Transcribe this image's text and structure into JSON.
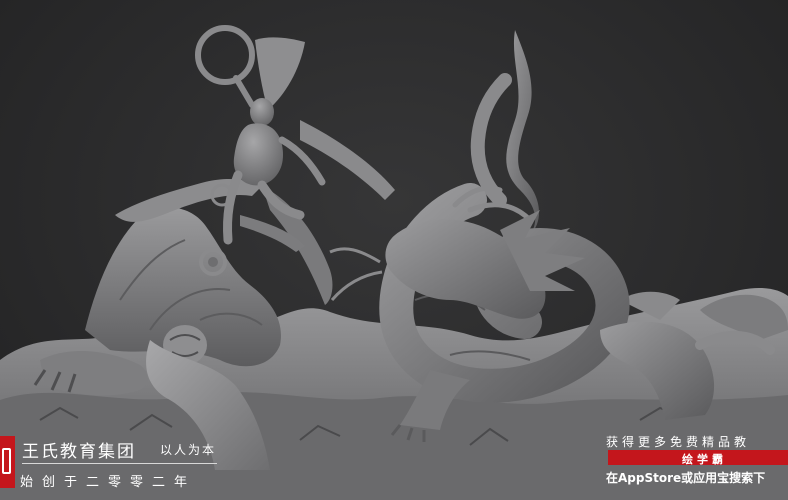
{
  "image": {
    "subject": "",
    "background_color": "#2a2a2b",
    "sculpt_color": "#8a8a8c"
  },
  "brand": {
    "name": "王氏教育集团",
    "slogan": "以人为本",
    "founded": "始创于二零零二年",
    "logo_color": "#c4161c"
  },
  "promo": {
    "line1": "获得更多免费精品教",
    "app_name": "绘学霸",
    "line3": "在AppStore或应用宝搜索下",
    "bar_color": "#c4161c"
  }
}
